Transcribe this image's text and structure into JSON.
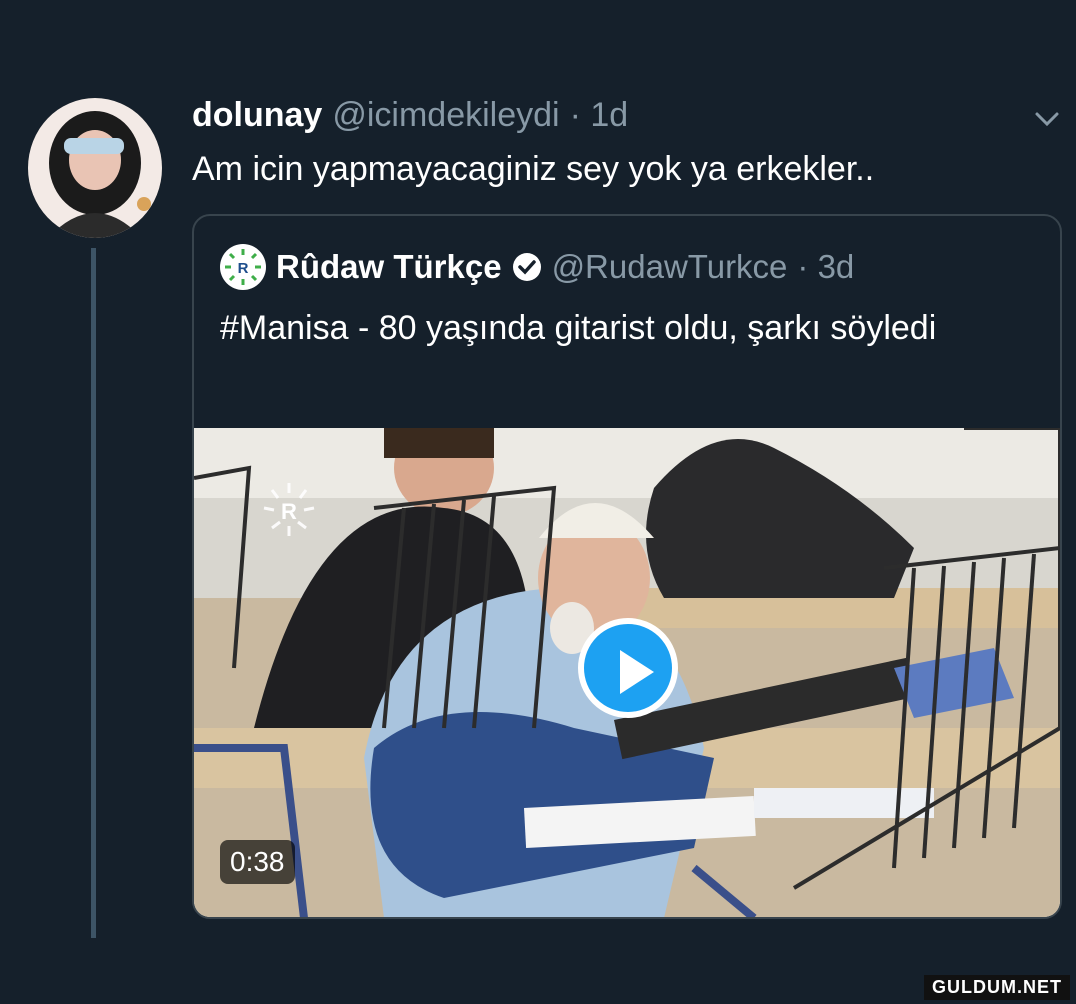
{
  "tweet": {
    "author_name": "dolunay",
    "author_handle": "@icimdekileydi",
    "time": "· 1d",
    "text": "Am icin yapmayacaginiz sey yok ya erkekler.."
  },
  "quoted_tweet": {
    "author_name": "Rûdaw Türkçe",
    "author_handle": "@RudawTurkce",
    "time": "· 3d",
    "text": "#Manisa - 80 yaşında gitarist oldu, şarkı söyledi",
    "logo_letter": "R",
    "video": {
      "duration": "0:38",
      "overlay_logo_letter": "R"
    }
  },
  "watermark": "GULDUM.NET",
  "icons": {
    "verified": "verified-badge-icon",
    "menu": "chevron-down-icon",
    "play": "play-icon"
  },
  "colors": {
    "background": "#15202b",
    "secondary_text": "#8899a6",
    "accent": "#1da1f2",
    "border": "#38444d"
  }
}
